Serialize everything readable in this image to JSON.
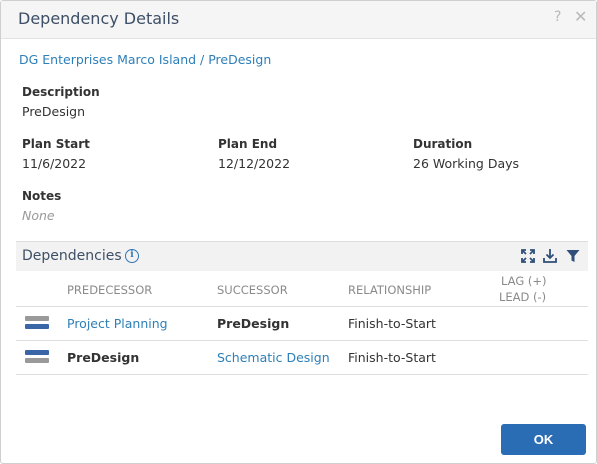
{
  "dialog": {
    "title": "Dependency Details",
    "help_glyph": "?",
    "close_glyph": "✕"
  },
  "breadcrumb": "DG Enterprises Marco Island / PreDesign",
  "details": {
    "description_label": "Description",
    "description_value": "PreDesign",
    "plan_start_label": "Plan Start",
    "plan_start_value": "11/6/2022",
    "plan_end_label": "Plan End",
    "plan_end_value": "12/12/2022",
    "duration_label": "Duration",
    "duration_value": "26 Working Days",
    "notes_label": "Notes",
    "notes_value": "None"
  },
  "dependencies": {
    "title": "Dependencies",
    "info_glyph": "i",
    "columns": {
      "predecessor": "PREDECESSOR",
      "successor": "SUCCESSOR",
      "relationship": "RELATIONSHIP",
      "lag_line1": "LAG (+)",
      "lag_line2": "LEAD (-)"
    },
    "rows": [
      {
        "predecessor": "Project Planning",
        "successor": "PreDesign",
        "relationship": "Finish-to-Start",
        "lag": ""
      },
      {
        "predecessor": "PreDesign",
        "successor": "Schematic Design",
        "relationship": "Finish-to-Start",
        "lag": ""
      }
    ]
  },
  "footer": {
    "ok_label": "OK"
  },
  "colors": {
    "accent": "#2a6db5",
    "link": "#2d7fb8",
    "title": "#3d4f66",
    "bar_dark": "#3a66a8",
    "bar_gray": "#9a9a9a"
  }
}
